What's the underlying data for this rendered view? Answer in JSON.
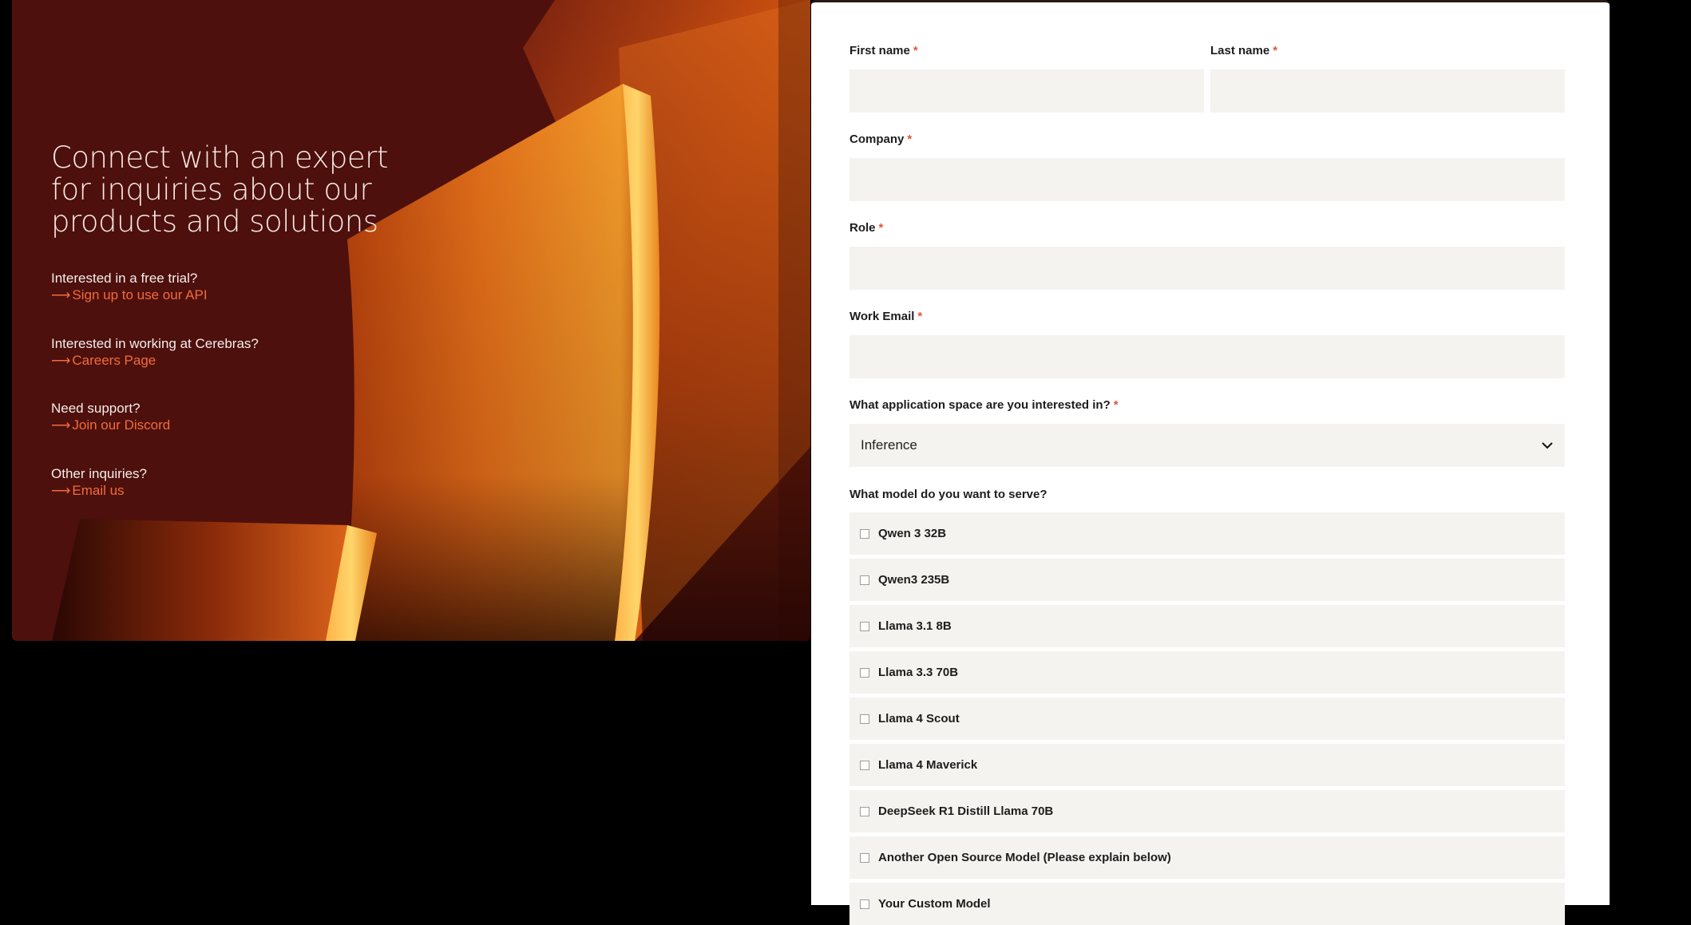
{
  "hero": {
    "title_lines": [
      "Connect with an expert",
      "for inquiries about our",
      "products and solutions"
    ],
    "ctas": [
      {
        "question": "Interested in a free trial?",
        "link": "Sign up to use our API"
      },
      {
        "question": "Interested in working at Cerebras?",
        "link": "Careers Page"
      },
      {
        "question": "Need support?",
        "link": "Join our Discord"
      },
      {
        "question": "Other inquiries?",
        "link": "Email us"
      }
    ],
    "arrow_glyph": "⟶",
    "link_color": "#f26b3c"
  },
  "form": {
    "required_mark": "*",
    "first_name": {
      "label": "First name",
      "value": ""
    },
    "last_name": {
      "label": "Last name",
      "value": ""
    },
    "company": {
      "label": "Company",
      "value": ""
    },
    "role": {
      "label": "Role",
      "value": ""
    },
    "work_email": {
      "label": "Work Email",
      "value": ""
    },
    "application_space": {
      "label": "What application space are you interested in?",
      "selected": "Inference",
      "icon": "chevron-down-icon"
    },
    "model": {
      "label": "What model do you want to serve?",
      "options": [
        {
          "label": "Qwen 3 32B",
          "checked": false
        },
        {
          "label": "Qwen3 235B",
          "checked": false
        },
        {
          "label": "Llama 3.1 8B",
          "checked": false
        },
        {
          "label": "Llama 3.3 70B",
          "checked": false
        },
        {
          "label": "Llama 4 Scout",
          "checked": false
        },
        {
          "label": "Llama 4 Maverick",
          "checked": false
        },
        {
          "label": "DeepSeek R1 Distill Llama 70B",
          "checked": false
        },
        {
          "label": "Another Open Source Model (Please explain below)",
          "checked": false
        },
        {
          "label": "Your Custom Model",
          "checked": false
        }
      ]
    }
  }
}
